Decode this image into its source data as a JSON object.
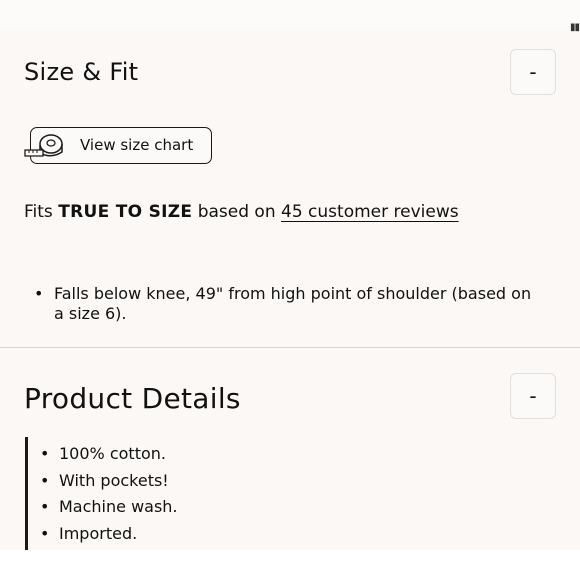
{
  "size_fit": {
    "title": "Size & Fit",
    "toggle_label": "-",
    "size_chart_label": "View size chart",
    "fit_prefix": "Fits ",
    "fit_strong": "TRUE TO SIZE",
    "fit_middle": " based on ",
    "fit_link": "45 customer reviews",
    "measurements": [
      "Falls below knee, 49\" from high point of shoulder (based on a size 6)."
    ]
  },
  "product_details": {
    "title": "Product Details",
    "toggle_label": "-",
    "items": [
      "100% cotton.",
      "With pockets!",
      "Machine wash.",
      "Imported."
    ]
  },
  "icons": {
    "toggle": "minus-icon",
    "size_chart": "measuring-tape-icon"
  }
}
